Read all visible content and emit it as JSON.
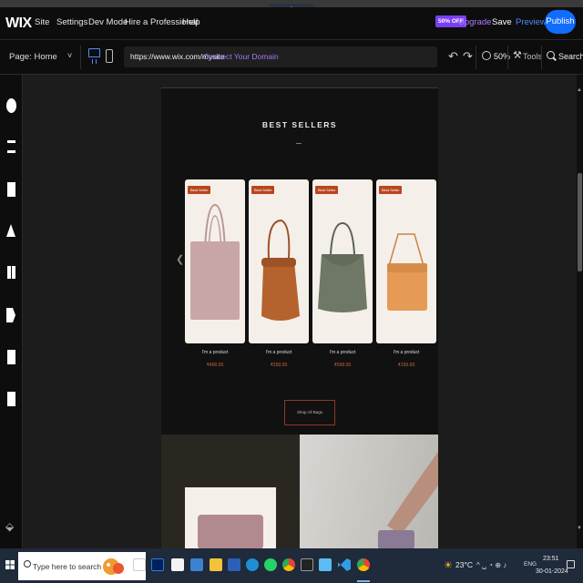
{
  "topbar": {
    "logo": "WIX",
    "menu": [
      "Site",
      "Settings",
      "Dev Mode",
      "Hire a Professional",
      "Help"
    ],
    "promo_badge": "50% OFF",
    "upgrade": "Upgrade",
    "save": "Save",
    "preview": "Preview",
    "publish": "Publish"
  },
  "toolbar": {
    "page_label": "Page:  Home",
    "url": "https://www.wix.com/mysite",
    "connect_domain": "Connect Your Domain",
    "zoom": "50%",
    "tools": "Tools",
    "search": "Search"
  },
  "site": {
    "section_title": "BEST SELLERS",
    "products": [
      {
        "tag": "Best Seller",
        "name": "I'm a product",
        "price": "₹400.00",
        "color": "#c9a6a6"
      },
      {
        "tag": "Best Seller",
        "name": "I'm a product",
        "price": "₹250.00",
        "color": "#b5622e"
      },
      {
        "tag": "Best Seller",
        "name": "I'm a product",
        "price": "₹500.00",
        "color": "#6f7866"
      },
      {
        "tag": "Best Seller",
        "name": "I'm a product",
        "price": "₹150.00",
        "color": "#e59a56"
      }
    ],
    "shop_button": "Shop All Bags"
  },
  "taskbar": {
    "search_placeholder": "Type here to search",
    "weather": "23°C",
    "tray": "^ ␣ ◔ ⊕ ♪",
    "lang": "ENG",
    "time": "23:51",
    "date": "30-01-2024"
  },
  "colors": {
    "accent": "#116dff",
    "upgrade_purple": "#7b3ff2",
    "price_orange": "#d2683a",
    "tag_bg": "#b8471e"
  }
}
